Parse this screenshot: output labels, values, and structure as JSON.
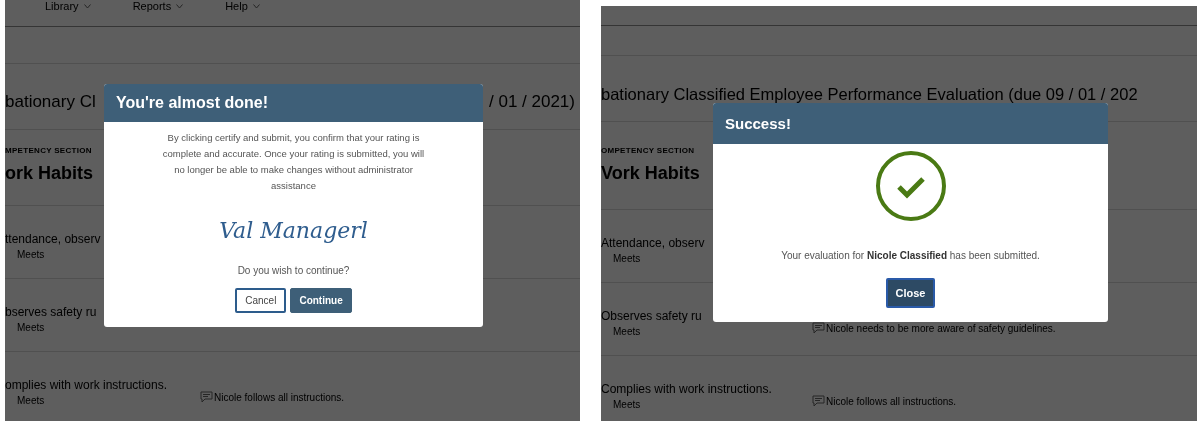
{
  "panels": [
    {
      "nav_menu": [
        {
          "label": "Library"
        },
        {
          "label": "Reports"
        },
        {
          "label": "Help"
        }
      ],
      "page_title": [
        "bationary Cl",
        "/ 01 / 2021)"
      ],
      "section_label": "MPETENCY SECTION",
      "section_title": "ork Habits",
      "criteria": [
        {
          "name": "ttendance, observ",
          "rating": "Meets"
        },
        {
          "name": "bserves safety ru",
          "rating": "Meets"
        },
        {
          "name": "omplies with work instructions.",
          "rating": "Meets",
          "comment": "Nicole follows all instructions."
        }
      ],
      "dialog": {
        "kind": "confirm",
        "title": "You're almost done!",
        "message": "By clicking certify and submit, you confirm that your rating is complete and accurate. Once your rating is submitted, you will no longer be able to make changes without administrator assistance",
        "signature": "Val Managerl",
        "question": "Do you wish to continue?",
        "buttons": [
          {
            "label": "Cancel",
            "kind": "secondary"
          },
          {
            "label": "Continue",
            "kind": "primary"
          }
        ]
      }
    },
    {
      "page_title": [
        "bationary Classified Employee Performance Evaluation (due 09 / 01 / 202"
      ],
      "section_label": "OMPETENCY SECTION",
      "section_title": "Vork Habits",
      "criteria": [
        {
          "name": "Attendance, observ",
          "rating": "Meets"
        },
        {
          "name": "Observes safety ru",
          "rating": "Meets",
          "comment": "Nicole needs to be more aware of safety guidelines."
        },
        {
          "name": "Complies with work instructions.",
          "rating": "Meets",
          "comment": "Nicole follows all instructions."
        }
      ],
      "dialog": {
        "kind": "success",
        "title": "Success!",
        "message": "Your evaluation for **Nicole Classified** has been submitted.",
        "buttons": [
          {
            "label": "Close",
            "kind": "primary"
          }
        ]
      }
    }
  ]
}
